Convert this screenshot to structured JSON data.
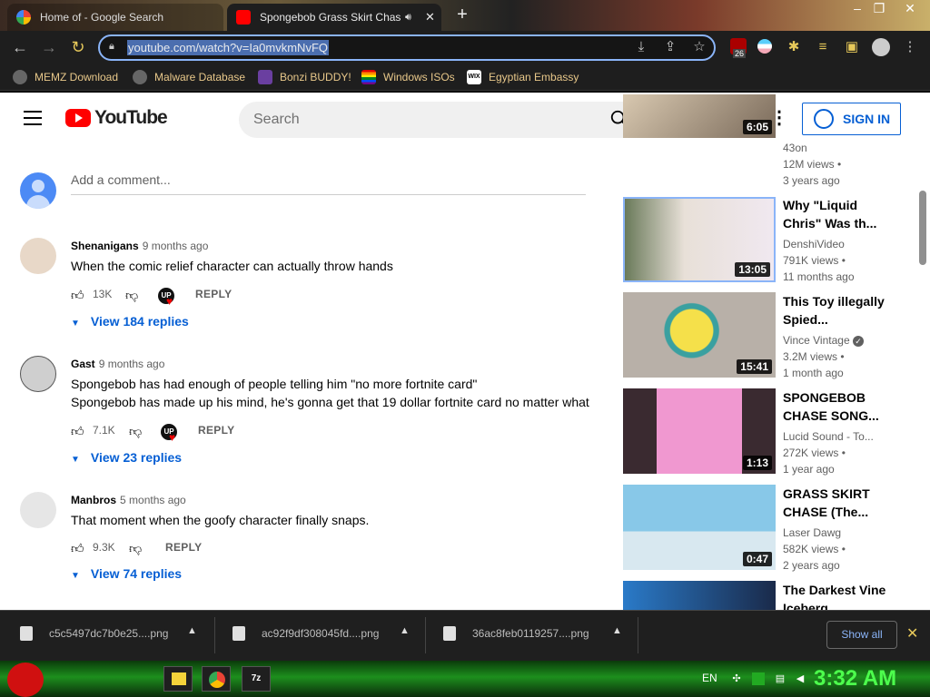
{
  "browser": {
    "tabs": [
      {
        "title": "Home of - Google Search"
      },
      {
        "title": "Spongebob Grass Skirt Chas",
        "muted_icon": "speaker-icon"
      }
    ],
    "new_tab_label": "+",
    "url": "youtube.com/watch?v=Ia0mvkmNvFQ",
    "extension_badge": "26",
    "bookmarks": [
      {
        "label": "MEMZ Download",
        "icon": "globe-icon"
      },
      {
        "label": "Malware Database",
        "icon": "globe-icon"
      },
      {
        "label": "Bonzi BUDDY!",
        "icon": "bonzi-icon"
      },
      {
        "label": "Windows ISOs",
        "icon": "windows-icon"
      },
      {
        "label": "Egyptian Embassy",
        "icon": "wix-icon"
      }
    ]
  },
  "youtube": {
    "logo_text": "YouTube",
    "search_placeholder": "Search",
    "signin_label": "SIGN IN",
    "add_comment_placeholder": "Add a comment...",
    "comments": [
      {
        "author": "Shenanigans",
        "time": "9 months ago",
        "lines": [
          "When the comic relief character can actually throw hands"
        ],
        "likes": "13K",
        "reply": "REPLY",
        "view_replies": "View 184 replies"
      },
      {
        "author": "Gast",
        "time": "9 months ago",
        "lines": [
          "Spongebob has had enough of people telling him \"no more fortnite card\"",
          "Spongebob has made up his mind, he's gonna get that 19 dollar fortnite card no matter what"
        ],
        "likes": "7.1K",
        "reply": "REPLY",
        "view_replies": "View 23 replies"
      },
      {
        "author": "Manbros",
        "time": "5 months ago",
        "lines": [
          "That moment when the goofy character finally snaps."
        ],
        "likes": "9.3K",
        "reply": "REPLY",
        "view_replies": "View 74 replies"
      }
    ],
    "heart_badge": "UP",
    "sidebar": [
      {
        "title": "",
        "channel": "43on",
        "views": "12M views",
        "age": "3 years ago",
        "duration": "6:05"
      },
      {
        "title": "Why \"Liquid Chris\" Was th...",
        "channel": "DenshiVideo",
        "views": "791K views",
        "age": "11 months ago",
        "duration": "13:05"
      },
      {
        "title": "This Toy illegally Spied...",
        "channel": "Vince Vintage",
        "verified": true,
        "views": "3.2M views",
        "age": "1 month ago",
        "duration": "15:41"
      },
      {
        "title": "SPONGEBOB CHASE SONG...",
        "channel": "Lucid Sound - To...",
        "views": "272K views",
        "age": "1 year ago",
        "duration": "1:13"
      },
      {
        "title": "GRASS SKIRT CHASE (The...",
        "channel": "Laser Dawg",
        "views": "582K views",
        "age": "2 years ago",
        "duration": "0:47"
      },
      {
        "title": "The Darkest Vine Iceberg",
        "channel": "",
        "views": "",
        "age": "",
        "duration": ""
      }
    ]
  },
  "downloads": {
    "items": [
      "c5c5497dc7b0e25....png",
      "ac92f9df308045fd....png",
      "36ac8feb0119257....png"
    ],
    "show_all": "Show all"
  },
  "taskbar": {
    "language": "EN",
    "clock": "3:32 AM"
  }
}
